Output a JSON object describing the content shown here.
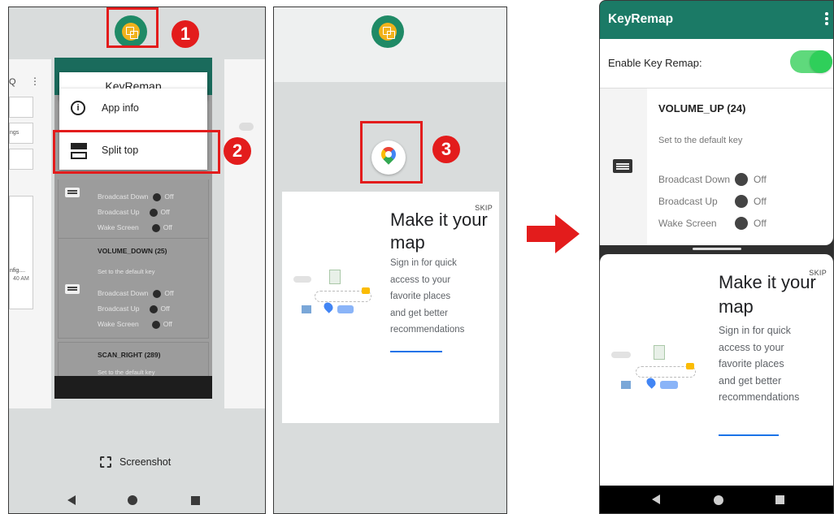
{
  "step_badges": [
    "1",
    "2",
    "3"
  ],
  "panel1": {
    "menu_title": "KeyRemap",
    "menu_items": [
      {
        "icon": "info-icon",
        "label": "App info"
      },
      {
        "icon": "split-screen-icon",
        "label": "Split top"
      }
    ],
    "left_card_text": {
      "search": "Q",
      "menu": "⋮",
      "field_label": "ngs",
      "file_name": "nfig....",
      "time": "40 AM"
    },
    "recent_card": {
      "first_rows": [
        {
          "label": "Broadcast Down",
          "state": "Off"
        },
        {
          "label": "Broadcast Up",
          "state": "Off"
        },
        {
          "label": "Wake Screen",
          "state": "Off"
        }
      ],
      "second": {
        "title": "VOLUME_DOWN (25)",
        "subtitle": "Set to the default key",
        "rows": [
          {
            "label": "Broadcast Down",
            "state": "Off"
          },
          {
            "label": "Broadcast Up",
            "state": "Off"
          },
          {
            "label": "Wake Screen",
            "state": "Off"
          }
        ]
      },
      "third": {
        "title": "SCAN_RIGHT (289)",
        "subtitle": "Set to the default key"
      }
    },
    "screenshot_label": "Screenshot"
  },
  "panel2": {
    "skip": "SKIP",
    "headline_line1": "Make it your",
    "headline_line2": "map",
    "body": [
      "Sign in for quick",
      "access to your",
      "favorite places",
      "and get better",
      "recommendations"
    ]
  },
  "panel3": {
    "app_title": "KeyRemap",
    "enable_label": "Enable Key Remap:",
    "toggle_on": true,
    "key_title": "VOLUME_UP (24)",
    "key_subtitle": "Set to the default key",
    "rows": [
      {
        "label": "Broadcast Down",
        "state": "Off"
      },
      {
        "label": "Broadcast Up",
        "state": "Off"
      },
      {
        "label": "Wake Screen",
        "state": "Off"
      }
    ],
    "skip": "SKIP",
    "headline_line1": "Make it your",
    "headline_line2": "map",
    "body": [
      "Sign in for quick",
      "access to your",
      "favorite places",
      "and get better",
      "recommendations"
    ]
  },
  "colors": {
    "accent_red": "#e31c1c",
    "teal_bar": "#1b7a66",
    "toggle_green": "#2fcf5a",
    "link_blue": "#1a73e8"
  }
}
